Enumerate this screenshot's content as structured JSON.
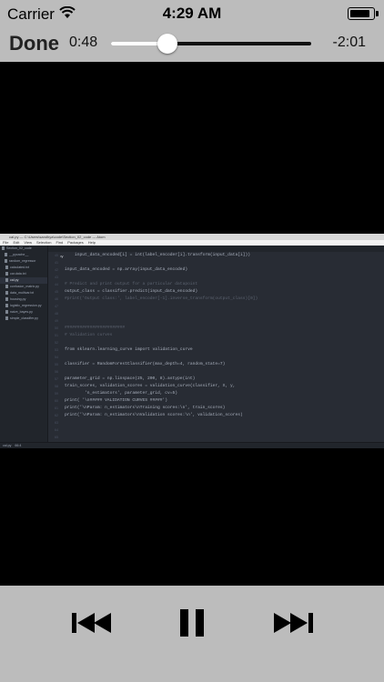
{
  "status_bar": {
    "carrier": "Carrier",
    "time": "4:29 AM",
    "battery_level": 0.9
  },
  "player": {
    "done_label": "Done",
    "elapsed": "0:48",
    "remaining": "-2:01",
    "progress": 0.28
  },
  "editor": {
    "window_title": "cal.py — C:\\Users\\sandhya\\code\\Section_02_code — Atom",
    "menu": [
      "File",
      "Edit",
      "View",
      "Selection",
      "Find",
      "Packages",
      "Help"
    ],
    "tab": "cal.py",
    "tree": [
      {
        "label": "Section_02_code"
      },
      {
        "label": "__pycache__"
      },
      {
        "label": "random_regressor"
      },
      {
        "label": "calculated.txt"
      },
      {
        "label": "car.data.txt"
      },
      {
        "label": "cal.py",
        "selected": true
      },
      {
        "label": "confusion_matrix.py"
      },
      {
        "label": "data_multivar.txt"
      },
      {
        "label": "housing.py"
      },
      {
        "label": "logistic_regression.py"
      },
      {
        "label": "naive_bayes.py"
      },
      {
        "label": "simple_classifier.py"
      }
    ],
    "line_numbers": [
      "40",
      "41",
      "42",
      "43",
      "44",
      "45",
      "46",
      "47",
      "48",
      "49",
      "50",
      "51",
      "52",
      "53",
      "54",
      "55",
      "56",
      "57",
      "58",
      "59",
      "60",
      "61",
      "62",
      "63",
      "64",
      "65",
      "66"
    ],
    "code": [
      {
        "text": "    input_data_encoded[i] = int(label_encoder[i].transform(input_data[i]))"
      },
      {
        "text": ""
      },
      {
        "text": "input_data_encoded = np.array(input_data_encoded)"
      },
      {
        "text": ""
      },
      {
        "text": "# Predict and print output for a particular datapoint",
        "comment": true
      },
      {
        "text": "output_class = classifier.predict(input_data_encoded)"
      },
      {
        "text": "#print('Output class:', label_encoder[-1].inverse_transform(output_class)[0])",
        "comment": true
      },
      {
        "text": ""
      },
      {
        "text": ""
      },
      {
        "text": ""
      },
      {
        "text": "########################",
        "comment": true
      },
      {
        "text": "# Validation curves",
        "comment": true
      },
      {
        "text": ""
      },
      {
        "text": "from sklearn.learning_curve import validation_curve"
      },
      {
        "text": ""
      },
      {
        "text": "classifier = RandomForestClassifier(max_depth=4, random_state=7)"
      },
      {
        "text": ""
      },
      {
        "text": "parameter_grid = np.linspace(25, 200, 8).astype(int)"
      },
      {
        "text": "train_scores, validation_scores = validation_curve(classifier, X, y,"
      },
      {
        "text": "        'n_estimators', parameter_grid, cv=5)"
      },
      {
        "text": "print( '\\n##### VALIDATION CURVES #####')"
      },
      {
        "text": "print('\\nParam: n_estimators\\nTraining scores:\\n', train_scores)"
      },
      {
        "text": "print('\\nParam: n_estimators\\nValidation scores:\\n', validation_scores)"
      },
      {
        "text": ""
      },
      {
        "text": ""
      },
      {
        "text": ""
      },
      {
        "text": ""
      }
    ],
    "status_file": "cal.py",
    "status_pos": "66:4"
  }
}
